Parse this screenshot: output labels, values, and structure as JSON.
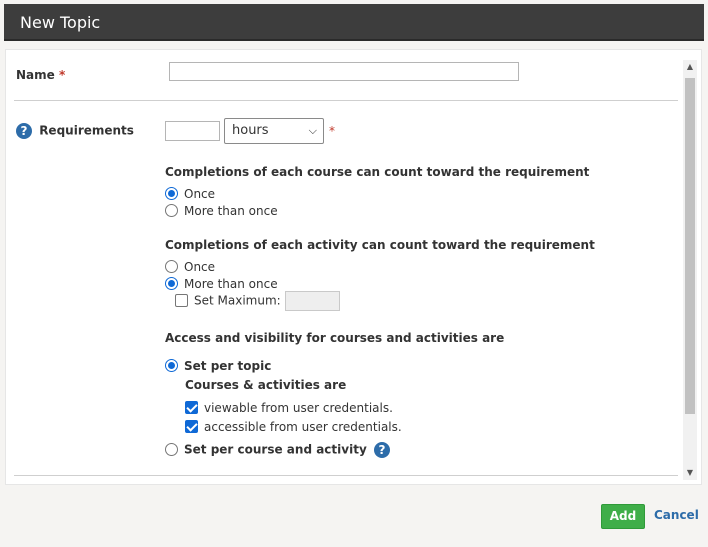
{
  "dialog": {
    "title": "New Topic"
  },
  "form": {
    "name_label": "Name",
    "required_star": "*",
    "name_value": "",
    "requirements_label": "Requirements",
    "requirements_value": "",
    "unit_selected": "hours",
    "course_section": {
      "title": "Completions of each course can count toward the requirement",
      "options": [
        "Once",
        "More than once"
      ],
      "selected": "Once"
    },
    "activity_section": {
      "title": "Completions of each activity can count toward the requirement",
      "options": [
        "Once",
        "More than once"
      ],
      "selected": "More than once",
      "set_max_label": "Set Maximum:",
      "set_max_checked": false,
      "set_max_value": ""
    },
    "access_section": {
      "title": "Access and visibility for courses and activities are",
      "per_topic_label": "Set per topic",
      "per_topic_sub": "Courses & activities are",
      "viewable_label": "viewable from user credentials.",
      "accessible_label": "accessible from user credentials.",
      "per_course_label": "Set per course and activity",
      "selected": "Set per topic",
      "viewable_checked": true,
      "accessible_checked": true
    }
  },
  "footer": {
    "add_label": "Add",
    "cancel_label": "Cancel"
  },
  "colors": {
    "titlebar": "#3d3d3d",
    "accent_blue": "#0f69d6",
    "add_green": "#3fae49",
    "link_blue": "#2d6ca9",
    "required_red": "#c0392b"
  },
  "icons": {
    "help": "question-circle-icon",
    "select_arrow": "chevron-down-icon"
  }
}
